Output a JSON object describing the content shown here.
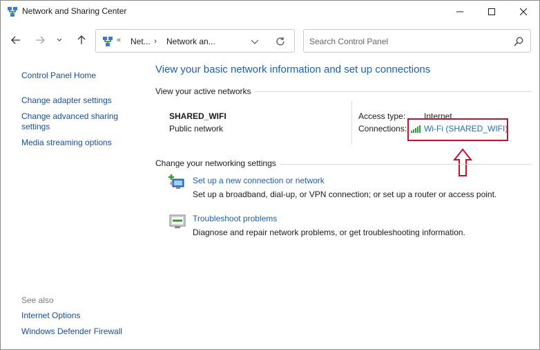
{
  "window": {
    "title": "Network and Sharing Center",
    "icon": "network-icon"
  },
  "address_bar": {
    "chevron": "«",
    "segments": [
      "Net...",
      "Network an..."
    ],
    "separator": "›",
    "refresh_icon": "refresh-icon",
    "dropdown_icon": "chevron-down-icon"
  },
  "search": {
    "placeholder": "Search Control Panel",
    "icon": "search-icon"
  },
  "sidebar": {
    "items": [
      {
        "label": "Control Panel Home"
      },
      {
        "label": "Change adapter settings"
      },
      {
        "label": "Change advanced sharing settings"
      },
      {
        "label": "Media streaming options"
      }
    ],
    "see_also_label": "See also",
    "see_also_items": [
      {
        "label": "Internet Options"
      },
      {
        "label": "Windows Defender Firewall"
      }
    ]
  },
  "main": {
    "title": "View your basic network information and set up connections",
    "active_networks_header": "View your active networks",
    "network": {
      "name": "SHARED_WIFI",
      "type": "Public network",
      "access_type_label": "Access type:",
      "access_type_value": "Internet",
      "connections_label": "Connections:",
      "connection_link": "Wi-Fi (SHARED_WIFI)",
      "connection_icon": "wifi-signal-icon"
    },
    "settings_header": "Change your networking settings",
    "tasks": [
      {
        "icon": "new-connection-icon",
        "link": "Set up a new connection or network",
        "description": "Set up a broadband, dial-up, or VPN connection; or set up a router or access point."
      },
      {
        "icon": "troubleshoot-icon",
        "link": "Troubleshoot problems",
        "description": "Diagnose and repair network problems, or get troubleshooting information."
      }
    ]
  },
  "colors": {
    "link": "#1e5fa8",
    "highlight": "#c8102e"
  }
}
